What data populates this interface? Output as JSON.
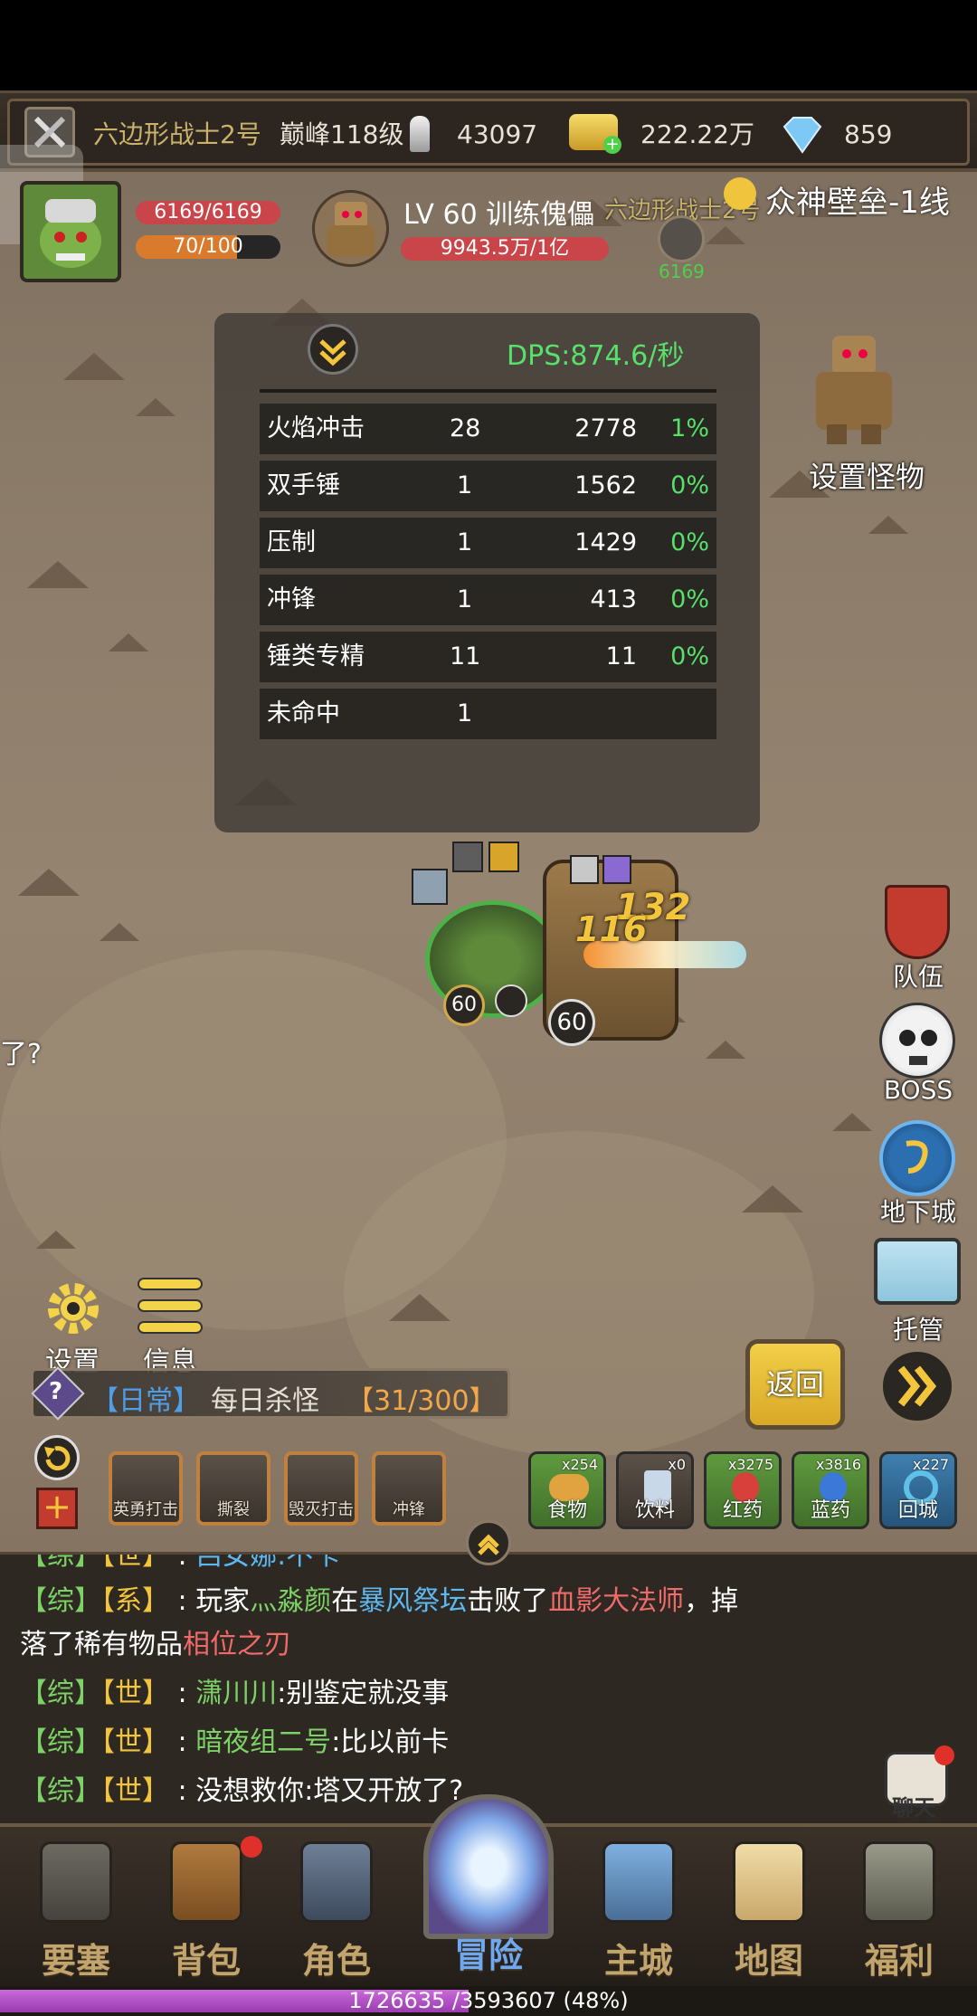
{
  "top_bar": {
    "player_name": "六边形战士2号",
    "level": "巅峰118级",
    "power": "43097",
    "gold": "222.22万",
    "diamonds": "859"
  },
  "player": {
    "hp": "6169/6169",
    "mp": "70/100"
  },
  "target": {
    "title": "LV 60 训练傀儡",
    "hp": "9943.5万/1亿"
  },
  "server": {
    "owner": "六边形战士2号",
    "name": "众神壁垒-1线",
    "owner_power": "6169"
  },
  "dps": {
    "label": "DPS:874.6/秒",
    "rows": [
      {
        "skill": "火焰冲击",
        "hits": "28",
        "damage": "2778",
        "pct": "1%"
      },
      {
        "skill": "双手锤",
        "hits": "1",
        "damage": "1562",
        "pct": "0%"
      },
      {
        "skill": "压制",
        "hits": "1",
        "damage": "1429",
        "pct": "0%"
      },
      {
        "skill": "冲锋",
        "hits": "1",
        "damage": "413",
        "pct": "0%"
      },
      {
        "skill": "锤类专精",
        "hits": "11",
        "damage": "11",
        "pct": "0%"
      },
      {
        "skill": "未命中",
        "hits": "1",
        "damage": "",
        "pct": ""
      }
    ]
  },
  "set_monster_label": "设置怪物",
  "right_menu": [
    "队伍",
    "BOSS",
    "地下城",
    "托管"
  ],
  "left_tools": {
    "settings": "设置",
    "info": "信息"
  },
  "side_chat_fragment": "了?",
  "battle": {
    "player_level": "60",
    "enemy_level": "60",
    "damage_numbers": [
      "132",
      "116"
    ]
  },
  "quest": {
    "tag": "【日常】",
    "title": "每日杀怪",
    "progress": "【31/300】"
  },
  "buttons": {
    "back": "返回"
  },
  "skills": [
    "英勇打击",
    "撕裂",
    "毁灭打击",
    "冲锋"
  ],
  "items": [
    {
      "label": "食物",
      "count": "x254",
      "color": "#e0a340"
    },
    {
      "label": "饮料",
      "count": "x0",
      "color": "#c8d8e8"
    },
    {
      "label": "红药",
      "count": "x3275",
      "color": "#d8403c"
    },
    {
      "label": "蓝药",
      "count": "x3816",
      "color": "#3c78d8"
    },
    {
      "label": "回城",
      "count": "x227",
      "color": "#5fc0e8"
    }
  ],
  "chat": {
    "line0": {
      "tag": "【综】",
      "channel": "【世】",
      "text": "吕女娜:不卡"
    },
    "line1": {
      "tag": "【综】",
      "channel": "【系】",
      "pre": "玩家",
      "player": "灬淼颜",
      "mid": "在",
      "place": "暴风祭坛",
      "mid2": "击败了",
      "boss": "血影大法师",
      "post": "，掉"
    },
    "line1b": {
      "pre": "落了稀有物品",
      "item": "相位之刃"
    },
    "line2": {
      "tag": "【综】",
      "channel": "【世】",
      "name": "潇川川",
      "text": ":别鉴定就没事"
    },
    "line3": {
      "tag": "【综】",
      "channel": "【世】",
      "name": "暗夜组二号",
      "text": ":比以前卡"
    },
    "line4": {
      "tag": "【综】",
      "channel": "【世】",
      "name": "没想救你",
      "text": ":塔又开放了?"
    },
    "chat_button": "聊天"
  },
  "nav": [
    "要塞",
    "背包",
    "角色",
    "冒险",
    "主城",
    "地图",
    "福利"
  ],
  "xp": {
    "text": "1726635 /3593607 (48%)",
    "fraction": 0.48
  },
  "colors": {
    "accent": "#f2c53c",
    "dps_green": "#57e06a",
    "hp_red": "#c9454a",
    "mp_orange": "#d97a2c"
  }
}
